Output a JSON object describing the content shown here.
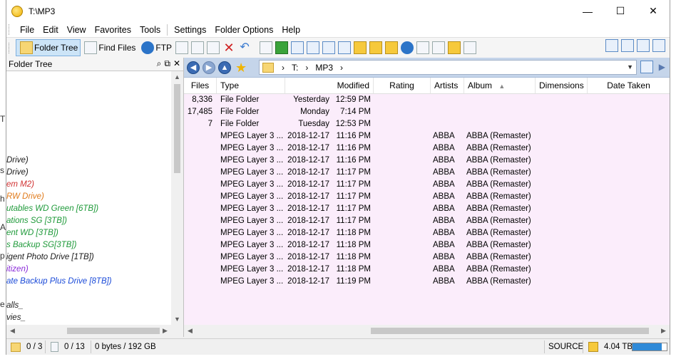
{
  "window": {
    "title": "T:\\MP3",
    "minimize": "—",
    "maximize": "☐",
    "close": "✕"
  },
  "menu": [
    "File",
    "Edit",
    "View",
    "Favorites",
    "Tools",
    "Settings",
    "Folder Options",
    "Help"
  ],
  "toolbar": {
    "folder_tree": "Folder Tree",
    "find_files": "Find Files",
    "ftp": "FTP"
  },
  "tree": {
    "header": "Folder Tree",
    "items": [
      {
        "text": "Drive)",
        "color": "#1a1a1a"
      },
      {
        "text": "Drive)",
        "color": "#1a1a1a"
      },
      {
        "text": "em M2)",
        "color": "#d03030"
      },
      {
        "text": "RW Drive)",
        "color": "#e07a1a"
      },
      {
        "text": "utables WD Green [6TB])",
        "color": "#1f9a3a"
      },
      {
        "text": "ations SG [3TB])",
        "color": "#1f9a3a"
      },
      {
        "text": "ent WD [3TB])",
        "color": "#1f9a3a"
      },
      {
        "text": "s Backup SG[3TB])",
        "color": "#1f9a3a"
      },
      {
        "text": "igent Photo Drive [1TB])",
        "color": "#1a1a1a"
      },
      {
        "text": "itizen)",
        "color": "#8a2bd8"
      },
      {
        "text": "ate Backup Plus Drive [8TB])",
        "color": "#1a4ad8"
      },
      {
        "text": "",
        "color": "#1a1a1a"
      },
      {
        "text": "alls_",
        "color": "#1a1a1a"
      },
      {
        "text": "vies_",
        "color": "#1a1a1a"
      }
    ]
  },
  "address": {
    "drive": "T:",
    "folder": "MP3",
    "sep1": "›",
    "sep2": "›",
    "sep3": "›"
  },
  "columns": {
    "files": "Files",
    "type": "Type",
    "modified": "Modified",
    "rating": "Rating",
    "artists": "Artists",
    "album": "Album",
    "dimensions": "Dimensions",
    "date_taken": "Date Taken"
  },
  "rows": [
    {
      "files": "8,336",
      "type": "File Folder",
      "date": "Yesterday",
      "time": "12:59 PM",
      "artists": "",
      "album": ""
    },
    {
      "files": "17,485",
      "type": "File Folder",
      "date": "Monday",
      "time": "7:14 PM",
      "artists": "",
      "album": ""
    },
    {
      "files": "7",
      "type": "File Folder",
      "date": "Tuesday",
      "time": "12:53 PM",
      "artists": "",
      "album": ""
    },
    {
      "files": "",
      "type": "MPEG Layer 3 ...",
      "date": "2018-12-17",
      "time": "11:16 PM",
      "artists": "ABBA",
      "album": "ABBA (Remaster)"
    },
    {
      "files": "",
      "type": "MPEG Layer 3 ...",
      "date": "2018-12-17",
      "time": "11:16 PM",
      "artists": "ABBA",
      "album": "ABBA (Remaster)"
    },
    {
      "files": "",
      "type": "MPEG Layer 3 ...",
      "date": "2018-12-17",
      "time": "11:16 PM",
      "artists": "ABBA",
      "album": "ABBA (Remaster)"
    },
    {
      "files": "",
      "type": "MPEG Layer 3 ...",
      "date": "2018-12-17",
      "time": "11:17 PM",
      "artists": "ABBA",
      "album": "ABBA (Remaster)"
    },
    {
      "files": "",
      "type": "MPEG Layer 3 ...",
      "date": "2018-12-17",
      "time": "11:17 PM",
      "artists": "ABBA",
      "album": "ABBA (Remaster)"
    },
    {
      "files": "",
      "type": "MPEG Layer 3 ...",
      "date": "2018-12-17",
      "time": "11:17 PM",
      "artists": "ABBA",
      "album": "ABBA (Remaster)"
    },
    {
      "files": "",
      "type": "MPEG Layer 3 ...",
      "date": "2018-12-17",
      "time": "11:17 PM",
      "artists": "ABBA",
      "album": "ABBA (Remaster)"
    },
    {
      "files": "",
      "type": "MPEG Layer 3 ...",
      "date": "2018-12-17",
      "time": "11:17 PM",
      "artists": "ABBA",
      "album": "ABBA (Remaster)"
    },
    {
      "files": "",
      "type": "MPEG Layer 3 ...",
      "date": "2018-12-17",
      "time": "11:18 PM",
      "artists": "ABBA",
      "album": "ABBA (Remaster)"
    },
    {
      "files": "",
      "type": "MPEG Layer 3 ...",
      "date": "2018-12-17",
      "time": "11:18 PM",
      "artists": "ABBA",
      "album": "ABBA (Remaster)"
    },
    {
      "files": "",
      "type": "MPEG Layer 3 ...",
      "date": "2018-12-17",
      "time": "11:18 PM",
      "artists": "ABBA",
      "album": "ABBA (Remaster)"
    },
    {
      "files": "",
      "type": "MPEG Layer 3 ...",
      "date": "2018-12-17",
      "time": "11:18 PM",
      "artists": "ABBA",
      "album": "ABBA (Remaster)"
    },
    {
      "files": "",
      "type": "MPEG Layer 3 ...",
      "date": "2018-12-17",
      "time": "11:19 PM",
      "artists": "ABBA",
      "album": "ABBA (Remaster)"
    }
  ],
  "status": {
    "folders": "0 / 3",
    "files": "0 / 13",
    "size": "0 bytes / 192 GB",
    "source": "SOURCE",
    "free": "4.04 TB",
    "usage_fraction": 0.85
  },
  "colors": {
    "list_bg": "#fbedfb",
    "address_bg": "#c5d5ea",
    "usage_bar": "#2f8ad8"
  }
}
